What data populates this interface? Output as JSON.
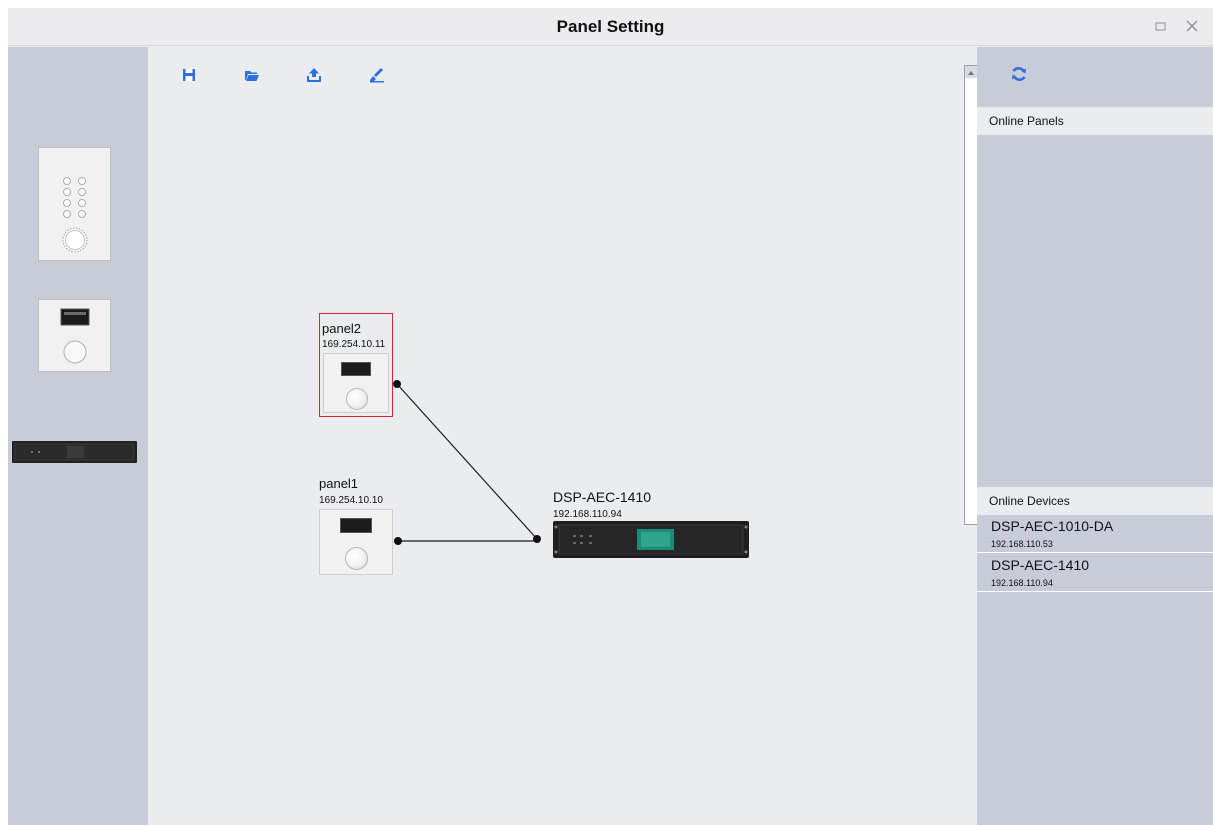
{
  "window": {
    "title": "Panel Setting",
    "maximize_icon": "maximize-icon",
    "close_icon": "close-icon"
  },
  "palette": {
    "items": [
      {
        "name": "Keypad panel with knob"
      },
      {
        "name": "LCD panel with knob"
      },
      {
        "name": "DSP rack device"
      }
    ]
  },
  "toolbar": {
    "icons": [
      "save-icon",
      "open-folder-icon",
      "upload-icon",
      "clear-icon"
    ]
  },
  "canvas": {
    "nodes": [
      {
        "label": "panel2",
        "ip": "169.254.10.11"
      },
      {
        "label": "panel1",
        "ip": "169.254.10.10"
      },
      {
        "label": "DSP-AEC-1410",
        "ip": "192.168.110.94"
      }
    ]
  },
  "sidebar": {
    "refresh_icon": "refresh-icon",
    "online_panels_header": "Online Panels",
    "online_devices_header": "Online Devices",
    "devices": [
      {
        "name": "DSP-AEC-1010-DA",
        "ip": "192.168.110.53"
      },
      {
        "name": "DSP-AEC-1410",
        "ip": "192.168.110.94"
      }
    ]
  },
  "colors": {
    "accent": "#2f6fe0",
    "selection": "#d12b2b",
    "sidebar_bg": "#c8ccd9",
    "canvas_bg": "#ebecf0"
  }
}
